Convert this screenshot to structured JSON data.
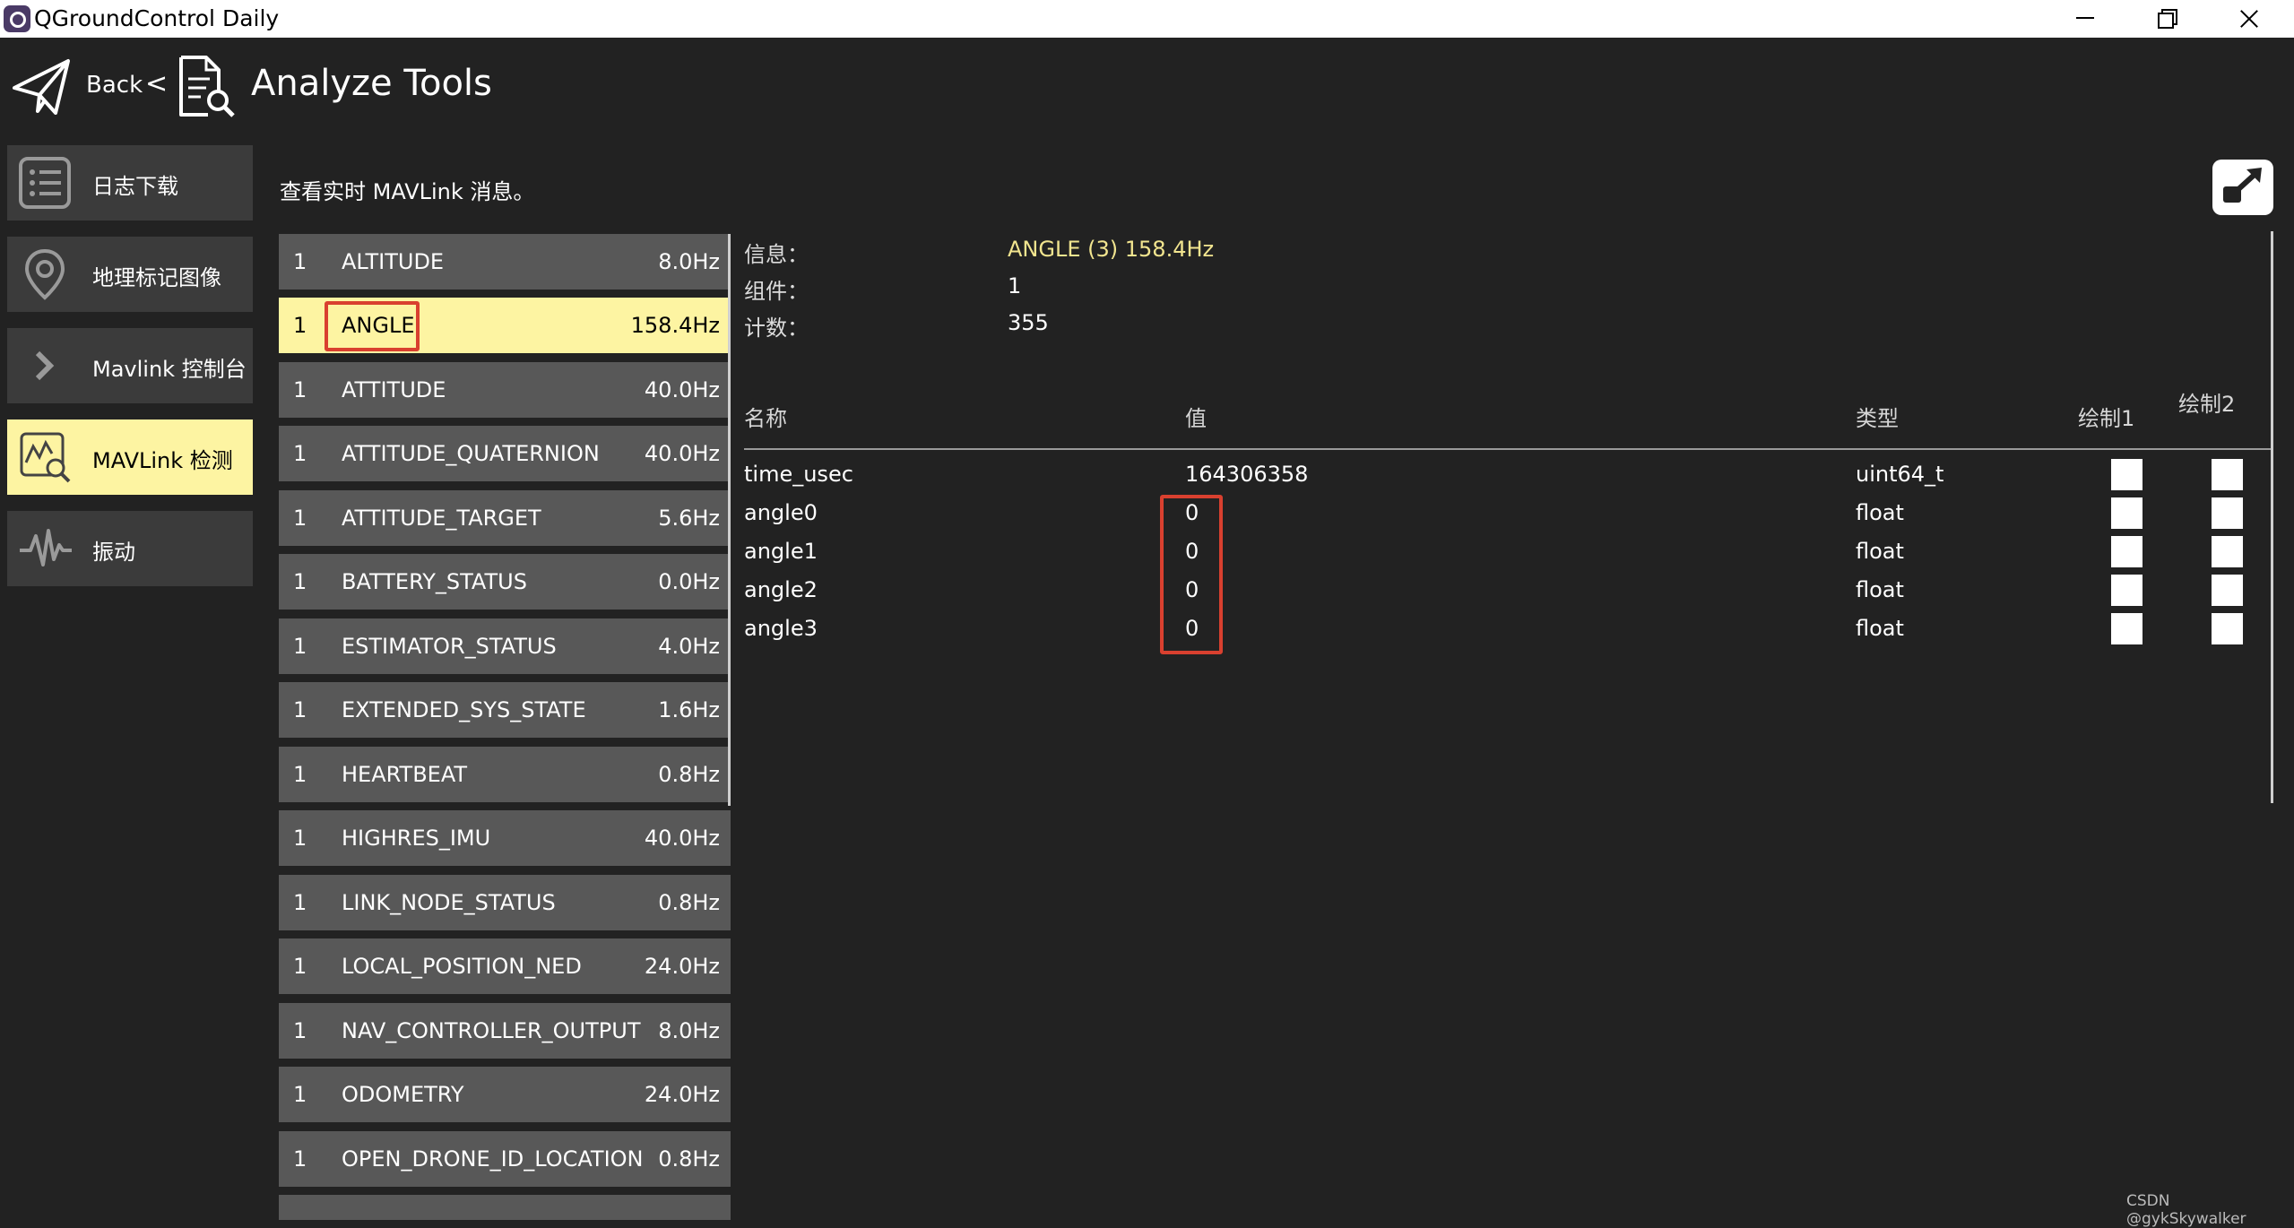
{
  "window": {
    "title": "QGroundControl Daily"
  },
  "toolbar": {
    "back_label": "Back",
    "separator": "<",
    "page_title": "Analyze Tools"
  },
  "sidebar": {
    "items": [
      {
        "label": "日志下载",
        "icon": "list-icon",
        "active": false
      },
      {
        "label": "地理标记图像",
        "icon": "map-pin-icon",
        "active": false
      },
      {
        "label": "Mavlink 控制台",
        "icon": "chevron-right-icon",
        "active": false
      },
      {
        "label": "MAVLink 检测",
        "icon": "chart-magnify-icon",
        "active": true
      },
      {
        "label": "振动",
        "icon": "vibration-icon",
        "active": false
      }
    ]
  },
  "description": "查看实时 MAVLink 消息。",
  "message_list": [
    {
      "component": "1",
      "name": "ALTITUDE",
      "rate": "8.0Hz"
    },
    {
      "component": "1",
      "name": "ANGLE",
      "rate": "158.4Hz",
      "selected": true
    },
    {
      "component": "1",
      "name": "ATTITUDE",
      "rate": "40.0Hz"
    },
    {
      "component": "1",
      "name": "ATTITUDE_QUATERNION",
      "rate": "40.0Hz"
    },
    {
      "component": "1",
      "name": "ATTITUDE_TARGET",
      "rate": "5.6Hz"
    },
    {
      "component": "1",
      "name": "BATTERY_STATUS",
      "rate": "0.0Hz"
    },
    {
      "component": "1",
      "name": "ESTIMATOR_STATUS",
      "rate": "4.0Hz"
    },
    {
      "component": "1",
      "name": "EXTENDED_SYS_STATE",
      "rate": "1.6Hz"
    },
    {
      "component": "1",
      "name": "HEARTBEAT",
      "rate": "0.8Hz"
    },
    {
      "component": "1",
      "name": "HIGHRES_IMU",
      "rate": "40.0Hz"
    },
    {
      "component": "1",
      "name": "LINK_NODE_STATUS",
      "rate": "0.8Hz"
    },
    {
      "component": "1",
      "name": "LOCAL_POSITION_NED",
      "rate": "24.0Hz"
    },
    {
      "component": "1",
      "name": "NAV_CONTROLLER_OUTPUT",
      "rate": "8.0Hz"
    },
    {
      "component": "1",
      "name": "ODOMETRY",
      "rate": "24.0Hz"
    },
    {
      "component": "1",
      "name": "OPEN_DRONE_ID_LOCATION",
      "rate": "0.8Hz"
    }
  ],
  "detail": {
    "message_label": "信息：",
    "message_value": "ANGLE (3) 158.4Hz",
    "component_label": "组件：",
    "component_value": "1",
    "count_label": "计数：",
    "count_value": "355",
    "columns": {
      "name": "名称",
      "value": "值",
      "type": "类型",
      "plot1": "绘制1",
      "plot2": "绘制2"
    },
    "fields": [
      {
        "name": "time_usec",
        "value": "164306358",
        "type": "uint64_t"
      },
      {
        "name": "angle0",
        "value": "0",
        "type": "float"
      },
      {
        "name": "angle1",
        "value": "0",
        "type": "float"
      },
      {
        "name": "angle2",
        "value": "0",
        "type": "float"
      },
      {
        "name": "angle3",
        "value": "0",
        "type": "float"
      }
    ]
  },
  "colors": {
    "background": "#222222",
    "sidebar_item": "#3b3b3b",
    "active_highlight": "#fdf4a2",
    "list_row": "#585858",
    "annotation_red": "#d9402f",
    "accent_text": "#f2e58f"
  },
  "watermark": "CSDN @gykSkywalker"
}
